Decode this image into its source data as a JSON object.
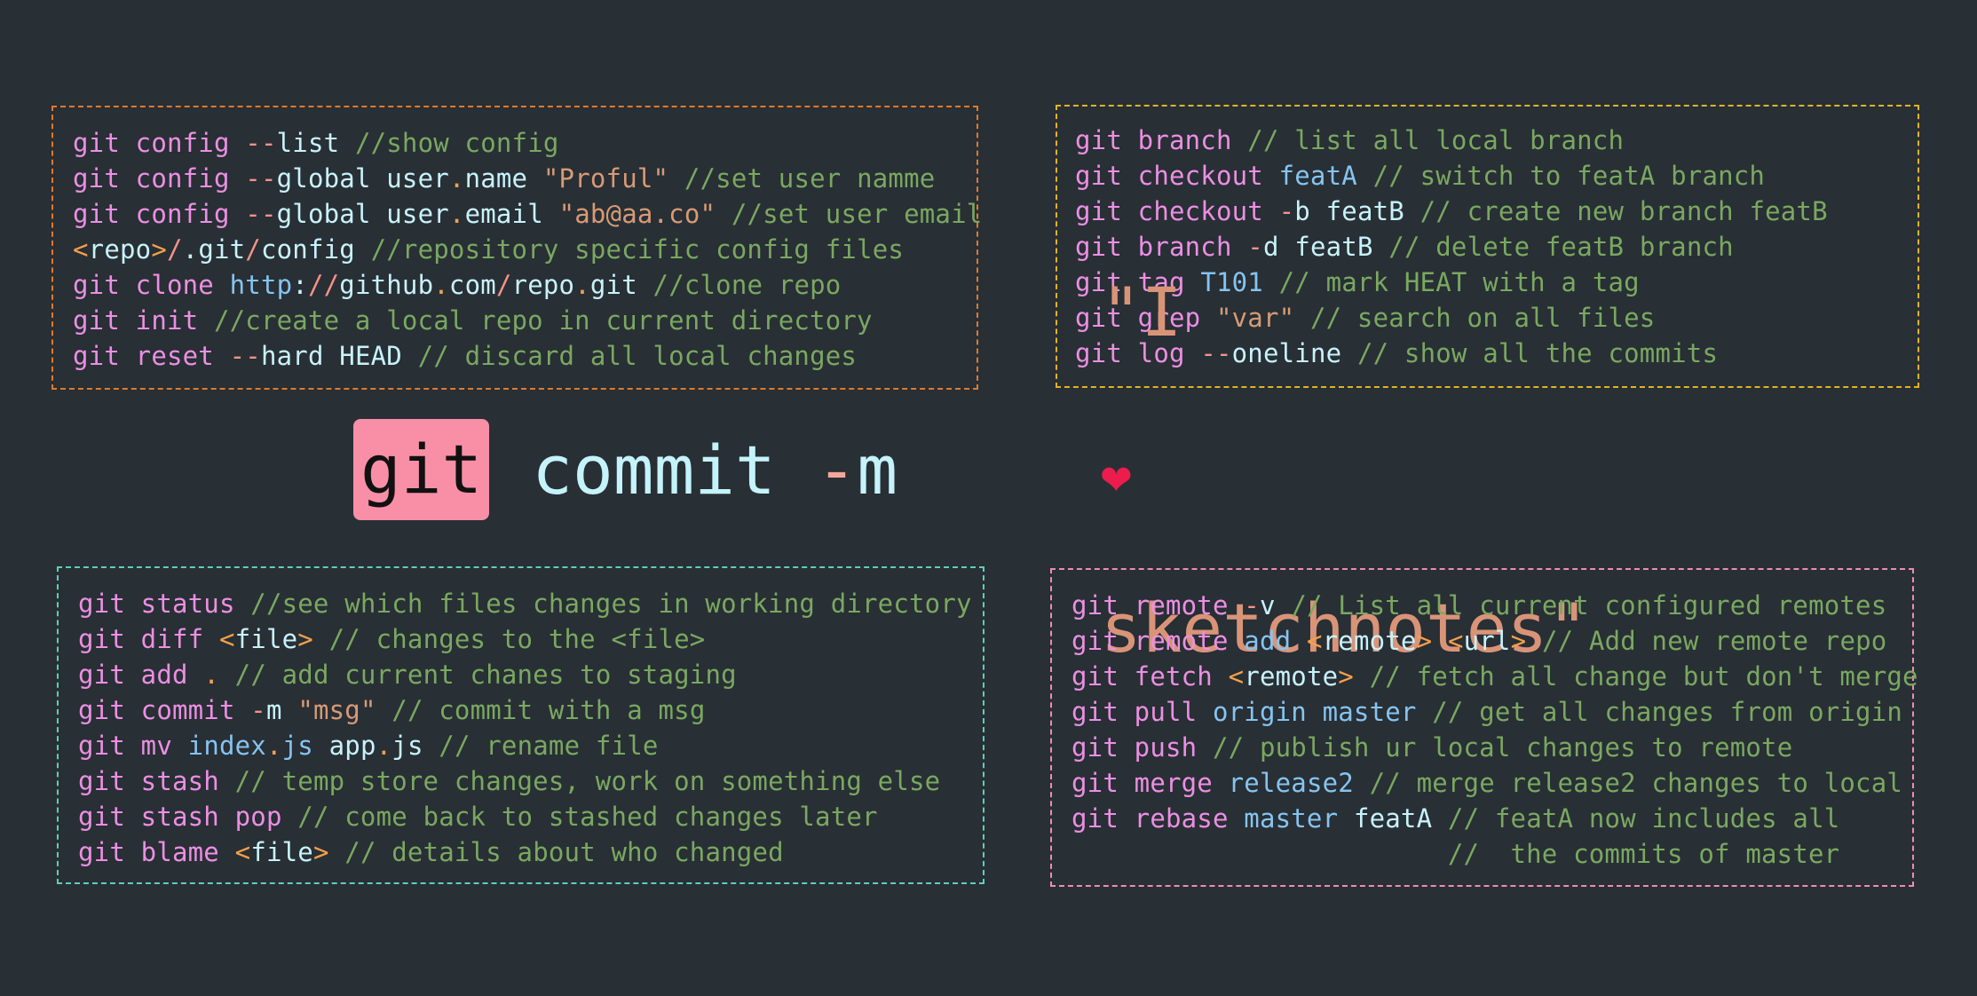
{
  "title": {
    "badge": "git",
    "command": "commit",
    "flag_dash": "-",
    "flag_letter": "m",
    "quote_open": "\"I",
    "heart": "❤",
    "message_rest": "sketchnotes\"",
    "badge_color": "#f98fa6",
    "heart_color": "#ec1c4c"
  },
  "boxes": {
    "config": {
      "border_color": "#e07a2a",
      "lines": [
        [
          [
            "git",
            "git"
          ],
          [
            " ",
            ""
          ],
          [
            "config",
            "cmd"
          ],
          [
            " ",
            ""
          ],
          [
            "--",
            "flag"
          ],
          [
            "list",
            "arg"
          ],
          [
            " ",
            ""
          ],
          [
            "//show config",
            "comment"
          ]
        ],
        [
          [
            "git",
            "git"
          ],
          [
            " ",
            ""
          ],
          [
            "config",
            "cmd"
          ],
          [
            " ",
            ""
          ],
          [
            "--",
            "flag"
          ],
          [
            "global",
            "arg"
          ],
          [
            " ",
            ""
          ],
          [
            "user",
            "arg"
          ],
          [
            ".",
            "punct"
          ],
          [
            "name",
            "arg"
          ],
          [
            " ",
            ""
          ],
          [
            "\"Proful\"",
            "str"
          ],
          [
            " ",
            ""
          ],
          [
            "//set user namme",
            "comment"
          ]
        ],
        [
          [
            "git",
            "git"
          ],
          [
            " ",
            ""
          ],
          [
            "config",
            "cmd"
          ],
          [
            " ",
            ""
          ],
          [
            "--",
            "flag"
          ],
          [
            "global",
            "arg"
          ],
          [
            " ",
            ""
          ],
          [
            "user",
            "arg"
          ],
          [
            ".",
            "punct"
          ],
          [
            "email",
            "arg"
          ],
          [
            " ",
            ""
          ],
          [
            "\"ab@aa.co\"",
            "str"
          ],
          [
            " ",
            ""
          ],
          [
            "//set user email",
            "comment"
          ]
        ],
        [
          [
            "<",
            "punct"
          ],
          [
            "repo",
            "arg"
          ],
          [
            ">",
            "punct"
          ],
          [
            "/",
            "slash"
          ],
          [
            ".git",
            "arg"
          ],
          [
            "/",
            "slash"
          ],
          [
            "config",
            "arg"
          ],
          [
            " ",
            ""
          ],
          [
            "//repository specific config files",
            "comment"
          ]
        ],
        [
          [
            "git",
            "git"
          ],
          [
            " ",
            ""
          ],
          [
            "clone",
            "cmd"
          ],
          [
            " ",
            ""
          ],
          [
            "http",
            "blue"
          ],
          [
            ":",
            "arg"
          ],
          [
            "//",
            "slash"
          ],
          [
            "github",
            "arg"
          ],
          [
            ".",
            "punct"
          ],
          [
            "com",
            "arg"
          ],
          [
            "/",
            "slash"
          ],
          [
            "repo",
            "arg"
          ],
          [
            ".",
            "punct"
          ],
          [
            "git",
            "arg"
          ],
          [
            " ",
            ""
          ],
          [
            "//clone repo",
            "comment"
          ]
        ],
        [
          [
            "git",
            "git"
          ],
          [
            " ",
            ""
          ],
          [
            "init",
            "cmd"
          ],
          [
            " ",
            ""
          ],
          [
            "//create a local repo in current directory",
            "comment"
          ]
        ],
        [
          [
            "git",
            "git"
          ],
          [
            " ",
            ""
          ],
          [
            "reset",
            "cmd"
          ],
          [
            " ",
            ""
          ],
          [
            "--",
            "flag"
          ],
          [
            "hard",
            "arg"
          ],
          [
            " ",
            ""
          ],
          [
            "HEAD",
            "arg"
          ],
          [
            " ",
            ""
          ],
          [
            "// discard all local changes",
            "comment"
          ]
        ]
      ]
    },
    "branch": {
      "border_color": "#e2b422",
      "lines": [
        [
          [
            "git",
            "git"
          ],
          [
            " ",
            ""
          ],
          [
            "branch",
            "cmd"
          ],
          [
            " ",
            ""
          ],
          [
            "// list all local branch",
            "comment"
          ]
        ],
        [
          [
            "git",
            "git"
          ],
          [
            " ",
            ""
          ],
          [
            "checkout",
            "cmd"
          ],
          [
            " ",
            ""
          ],
          [
            "featA",
            "blue"
          ],
          [
            " ",
            ""
          ],
          [
            "// switch to featA branch",
            "comment"
          ]
        ],
        [
          [
            "git",
            "git"
          ],
          [
            " ",
            ""
          ],
          [
            "checkout",
            "cmd"
          ],
          [
            " ",
            ""
          ],
          [
            "-",
            "flag"
          ],
          [
            "b",
            "arg"
          ],
          [
            " ",
            ""
          ],
          [
            "featB",
            "arg"
          ],
          [
            " ",
            ""
          ],
          [
            "// create new branch featB",
            "comment"
          ]
        ],
        [
          [
            "git",
            "git"
          ],
          [
            " ",
            ""
          ],
          [
            "branch",
            "cmd"
          ],
          [
            " ",
            ""
          ],
          [
            "-",
            "flag"
          ],
          [
            "d",
            "arg"
          ],
          [
            " ",
            ""
          ],
          [
            "featB",
            "arg"
          ],
          [
            " ",
            ""
          ],
          [
            "// delete featB branch",
            "comment"
          ]
        ],
        [
          [
            "git",
            "git"
          ],
          [
            " ",
            ""
          ],
          [
            "tag",
            "cmd"
          ],
          [
            " ",
            ""
          ],
          [
            "T101",
            "blue"
          ],
          [
            " ",
            ""
          ],
          [
            "// mark HEAT with a tag",
            "comment"
          ]
        ],
        [
          [
            "git",
            "git"
          ],
          [
            " ",
            ""
          ],
          [
            "grep",
            "cmd"
          ],
          [
            " ",
            ""
          ],
          [
            "\"var\"",
            "str"
          ],
          [
            " ",
            ""
          ],
          [
            "// search on all files",
            "comment"
          ]
        ],
        [
          [
            "git",
            "git"
          ],
          [
            " ",
            ""
          ],
          [
            "log",
            "cmd"
          ],
          [
            " ",
            ""
          ],
          [
            "--",
            "flag"
          ],
          [
            "oneline",
            "arg"
          ],
          [
            " ",
            ""
          ],
          [
            "// show all the commits",
            "comment"
          ]
        ]
      ]
    },
    "status": {
      "border_color": "#5fd0b4",
      "lines": [
        [
          [
            "git",
            "git"
          ],
          [
            " ",
            ""
          ],
          [
            "status",
            "cmd"
          ],
          [
            " ",
            ""
          ],
          [
            "//see which files changes in working directory",
            "comment"
          ]
        ],
        [
          [
            "git",
            "git"
          ],
          [
            " ",
            ""
          ],
          [
            "diff",
            "cmd"
          ],
          [
            " ",
            ""
          ],
          [
            "<",
            "punct"
          ],
          [
            "file",
            "arg"
          ],
          [
            ">",
            "punct"
          ],
          [
            " ",
            ""
          ],
          [
            "// changes to the <file>",
            "comment"
          ]
        ],
        [
          [
            "git",
            "git"
          ],
          [
            " ",
            ""
          ],
          [
            "add",
            "cmd"
          ],
          [
            " ",
            ""
          ],
          [
            ".",
            "punct"
          ],
          [
            " ",
            ""
          ],
          [
            "// add current chanes to staging",
            "comment"
          ]
        ],
        [
          [
            "git",
            "git"
          ],
          [
            " ",
            ""
          ],
          [
            "commit",
            "cmd"
          ],
          [
            " ",
            ""
          ],
          [
            "-",
            "flag"
          ],
          [
            "m",
            "arg"
          ],
          [
            " ",
            ""
          ],
          [
            "\"msg\"",
            "str"
          ],
          [
            " ",
            ""
          ],
          [
            "// commit with a msg",
            "comment"
          ]
        ],
        [
          [
            "git",
            "git"
          ],
          [
            " ",
            ""
          ],
          [
            "mv",
            "cmd"
          ],
          [
            " ",
            ""
          ],
          [
            "index",
            "blue"
          ],
          [
            ".",
            "punct"
          ],
          [
            "js",
            "blue"
          ],
          [
            " ",
            ""
          ],
          [
            "app",
            "arg"
          ],
          [
            ".",
            "punct"
          ],
          [
            "js",
            "arg"
          ],
          [
            " ",
            ""
          ],
          [
            "// rename file",
            "comment"
          ]
        ],
        [
          [
            "git",
            "git"
          ],
          [
            " ",
            ""
          ],
          [
            "stash",
            "cmd"
          ],
          [
            " ",
            ""
          ],
          [
            "// temp store changes, work on something else",
            "comment"
          ]
        ],
        [
          [
            "git",
            "git"
          ],
          [
            " ",
            ""
          ],
          [
            "stash",
            "cmd"
          ],
          [
            " ",
            ""
          ],
          [
            "pop",
            "cmd"
          ],
          [
            " ",
            ""
          ],
          [
            "// come back to stashed changes later",
            "comment"
          ]
        ],
        [
          [
            "git",
            "git"
          ],
          [
            " ",
            ""
          ],
          [
            "blame",
            "cmd"
          ],
          [
            " ",
            ""
          ],
          [
            "<",
            "punct"
          ],
          [
            "file",
            "arg"
          ],
          [
            ">",
            "punct"
          ],
          [
            " ",
            ""
          ],
          [
            "// details about who changed",
            "comment"
          ]
        ]
      ]
    },
    "remote": {
      "border_color": "#f08cb0",
      "lines": [
        [
          [
            "git",
            "git"
          ],
          [
            " ",
            ""
          ],
          [
            "remote",
            "cmd"
          ],
          [
            " ",
            ""
          ],
          [
            "-",
            "flag"
          ],
          [
            "v",
            "arg"
          ],
          [
            " ",
            ""
          ],
          [
            "// List all current configured remotes",
            "comment"
          ]
        ],
        [
          [
            "git",
            "git"
          ],
          [
            " ",
            ""
          ],
          [
            "remote",
            "cmd"
          ],
          [
            " ",
            ""
          ],
          [
            "add",
            "blue"
          ],
          [
            " ",
            ""
          ],
          [
            "<",
            "punct"
          ],
          [
            "remote",
            "arg"
          ],
          [
            ">",
            "punct"
          ],
          [
            " ",
            ""
          ],
          [
            "<",
            "punct"
          ],
          [
            "url",
            "arg"
          ],
          [
            ">",
            "punct"
          ],
          [
            " ",
            ""
          ],
          [
            "// Add new remote repo",
            "comment"
          ]
        ],
        [
          [
            "git",
            "git"
          ],
          [
            " ",
            ""
          ],
          [
            "fetch",
            "cmd"
          ],
          [
            " ",
            ""
          ],
          [
            "<",
            "punct"
          ],
          [
            "remote",
            "arg"
          ],
          [
            ">",
            "punct"
          ],
          [
            " ",
            ""
          ],
          [
            "// fetch all change but don't merge",
            "comment"
          ]
        ],
        [
          [
            "git",
            "git"
          ],
          [
            " ",
            ""
          ],
          [
            "pull",
            "cmd"
          ],
          [
            " ",
            ""
          ],
          [
            "origin",
            "blue"
          ],
          [
            " ",
            ""
          ],
          [
            "master",
            "blue"
          ],
          [
            " ",
            ""
          ],
          [
            "// get all changes from origin",
            "comment"
          ]
        ],
        [
          [
            "git",
            "git"
          ],
          [
            " ",
            ""
          ],
          [
            "push",
            "cmd"
          ],
          [
            " ",
            ""
          ],
          [
            "// publish ur local changes to remote",
            "comment"
          ]
        ],
        [
          [
            "git",
            "git"
          ],
          [
            " ",
            ""
          ],
          [
            "merge",
            "cmd"
          ],
          [
            " ",
            ""
          ],
          [
            "release2",
            "blue"
          ],
          [
            " ",
            ""
          ],
          [
            "// merge release2 changes to local",
            "comment"
          ]
        ],
        [
          [
            "git",
            "git"
          ],
          [
            " ",
            ""
          ],
          [
            "rebase",
            "cmd"
          ],
          [
            " ",
            ""
          ],
          [
            "master",
            "blue"
          ],
          [
            " ",
            ""
          ],
          [
            "featA",
            "arg"
          ],
          [
            " ",
            ""
          ],
          [
            "// featA now includes all",
            "comment"
          ]
        ],
        [
          [
            "                        ",
            ""
          ],
          [
            "//  the commits of master",
            "comment"
          ]
        ]
      ]
    }
  }
}
